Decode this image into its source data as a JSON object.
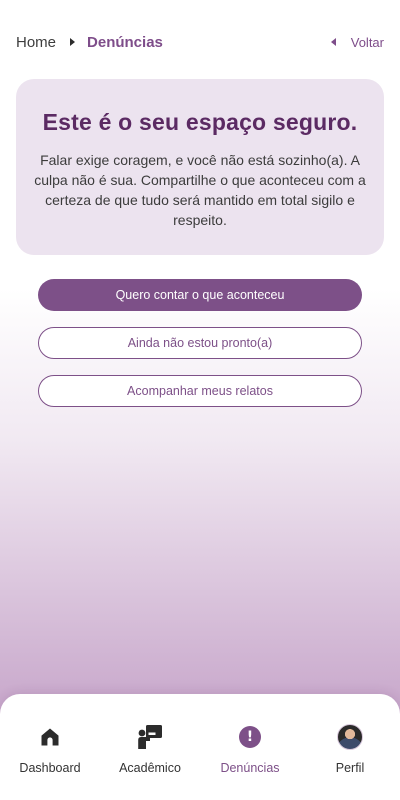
{
  "breadcrumb": {
    "home": "Home",
    "current": "Denúncias",
    "back": "Voltar"
  },
  "card": {
    "title": "Este é o seu espaço seguro.",
    "text": "Falar exige coragem, e você não está sozinho(a). A culpa não é sua. Compartilhe o que aconteceu com a certeza de que tudo será mantido em total sigilo e respeito."
  },
  "actions": {
    "tell": "Quero contar o que aconteceu",
    "not_ready": "Ainda não estou pronto(a)",
    "follow": "Acompanhar meus relatos"
  },
  "nav": {
    "items": [
      {
        "label": "Dashboard",
        "icon": "home-icon"
      },
      {
        "label": "Acadêmico",
        "icon": "teacher-board-icon"
      },
      {
        "label": "Denúncias",
        "icon": "alert-icon",
        "active": true
      },
      {
        "label": "Perfil",
        "icon": "avatar"
      }
    ]
  },
  "colors": {
    "accent": "#7d5088",
    "title": "#5b2a63",
    "card_bg": "#ece3ef"
  }
}
